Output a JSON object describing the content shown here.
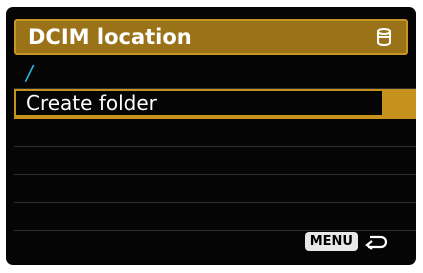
{
  "header": {
    "title": "DCIM location",
    "icon": "card-icon"
  },
  "path": {
    "value": "/"
  },
  "menu": {
    "items": [
      {
        "label": "Create folder",
        "selected": true
      }
    ]
  },
  "footer": {
    "menu_label": "MENU",
    "back_icon": "return-arrow-icon"
  },
  "colors": {
    "accent": "#c4921d",
    "title_bar": "#9a7218",
    "path_text": "#2fb6e7",
    "background": "#050505"
  }
}
